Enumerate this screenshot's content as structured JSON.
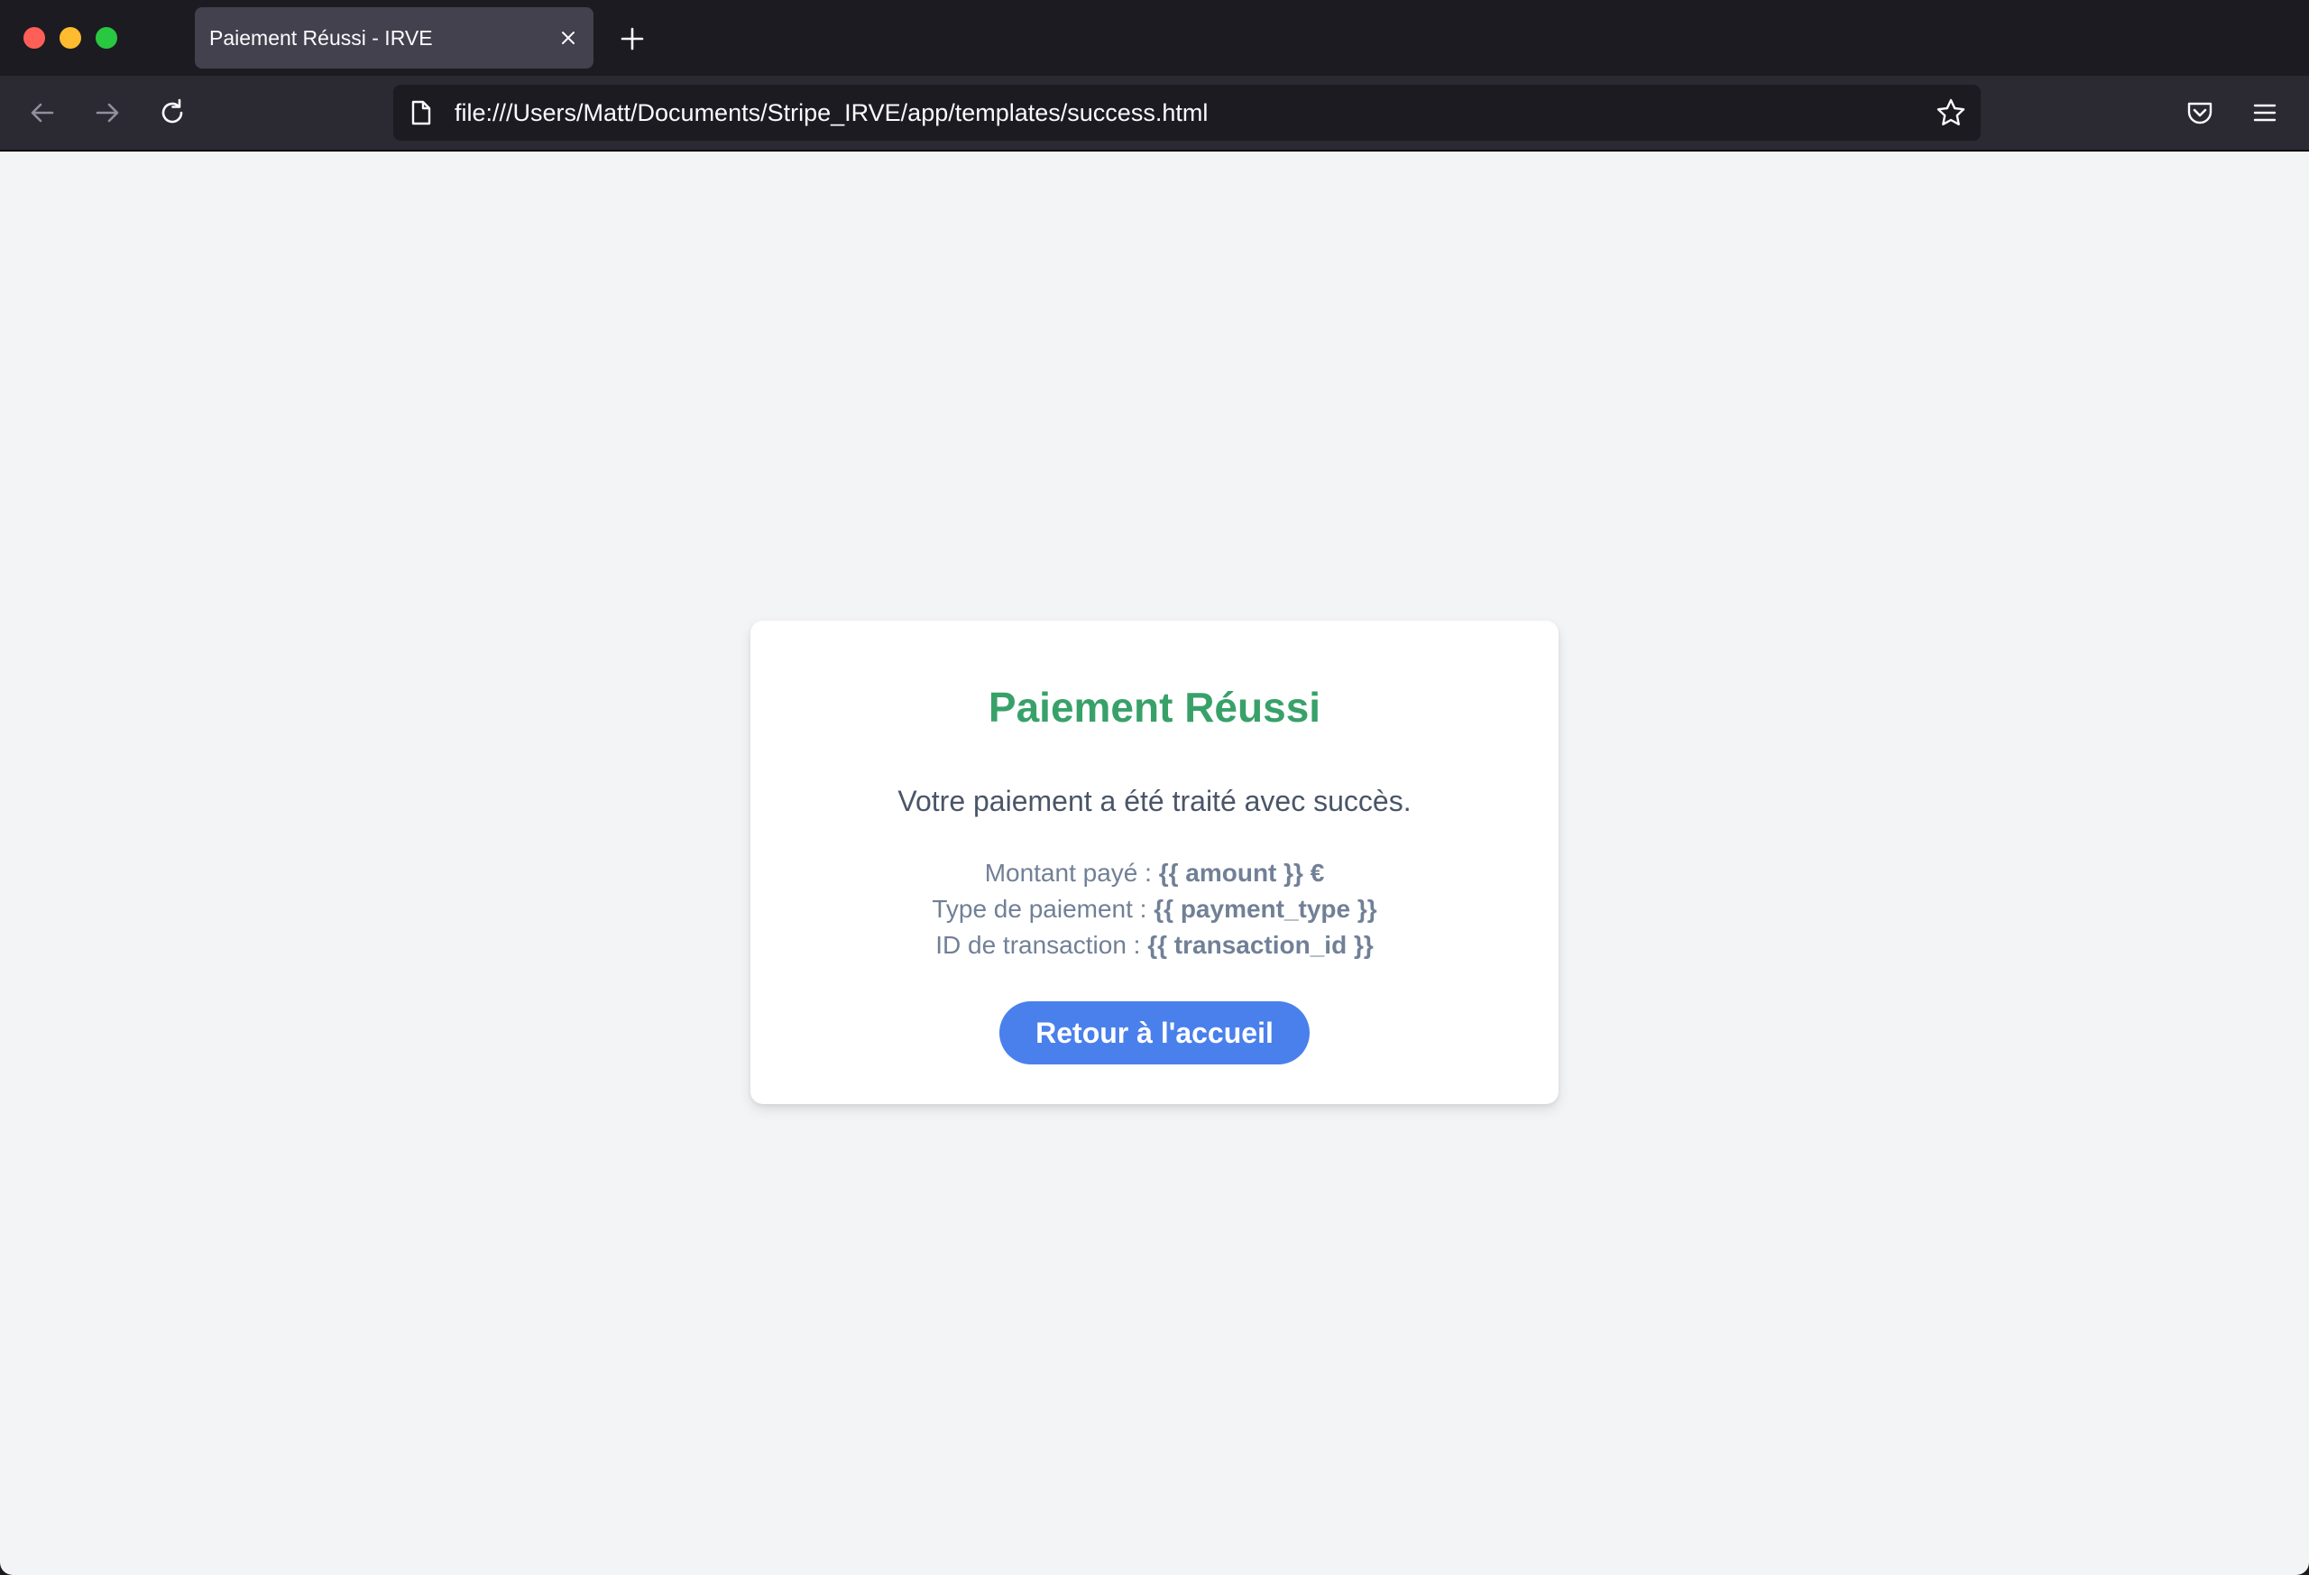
{
  "browser": {
    "tab": {
      "title": "Paiement Réussi - IRVE"
    },
    "url": "file:///Users/Matt/Documents/Stripe_IRVE/app/templates/success.html",
    "icons": {
      "close_tab": "close-icon",
      "new_tab": "plus-icon",
      "back": "arrow-left-icon",
      "forward": "arrow-right-icon",
      "reload": "reload-icon",
      "page": "page-icon",
      "bookmark": "star-icon",
      "pocket": "pocket-icon",
      "menu": "hamburger-menu-icon"
    }
  },
  "page": {
    "title": "Paiement Réussi",
    "message": "Votre paiement a été traité avec succès.",
    "details": {
      "amount_label": "Montant payé :",
      "amount_value": "{{ amount }} €",
      "type_label": "Type de paiement :",
      "type_value": "{{ payment_type }}",
      "transaction_label": "ID de transaction :",
      "transaction_value": "{{ transaction_id }}"
    },
    "button_label": "Retour à l'accueil"
  },
  "colors": {
    "title": "#38a169",
    "button": "#4a80ec",
    "page_background": "#f3f4f6",
    "chrome_background": "#1c1b22"
  }
}
